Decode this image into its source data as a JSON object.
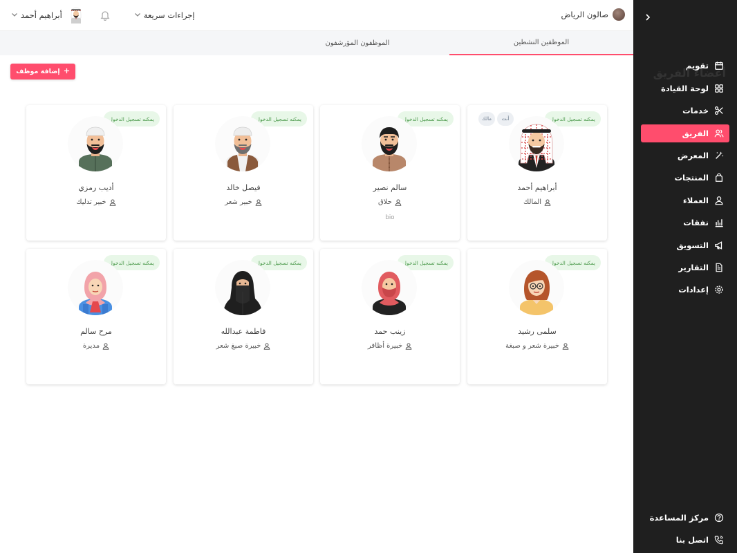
{
  "sidebar": {
    "items": [
      {
        "label": "تقويم",
        "icon": "calendar-icon",
        "active": false
      },
      {
        "label": "لوحة القيادة",
        "icon": "dashboard-grid-icon",
        "active": false
      },
      {
        "label": "خدمات",
        "icon": "scissors-icon",
        "active": false
      },
      {
        "label": "الفريق",
        "icon": "team-users-icon",
        "active": true
      },
      {
        "label": "المعرض",
        "icon": "sparkles-icon",
        "active": false
      },
      {
        "label": "المنتجات",
        "icon": "shopping-bag-icon",
        "active": false
      },
      {
        "label": "العملاء",
        "icon": "user-icon",
        "active": false
      },
      {
        "label": "نفقات",
        "icon": "bar-chart-icon",
        "active": false
      },
      {
        "label": "التسويق",
        "icon": "megaphone-icon",
        "active": false
      },
      {
        "label": "التقارير",
        "icon": "document-icon",
        "active": false
      },
      {
        "label": "إعدادات",
        "icon": "gear-icon",
        "active": false
      }
    ],
    "bottom": [
      {
        "label": "مركز المساعدة",
        "icon": "help-circle-icon"
      },
      {
        "label": "اتصل بنا",
        "icon": "phone-icon"
      }
    ]
  },
  "topbar": {
    "salon_name": "صالون الرياض",
    "quick_actions": "إجراءات سريعة",
    "user_name": "أبراهيم أحمد"
  },
  "tabs": {
    "active": "الموظفين النشطين",
    "archived": "الموظفون المؤرشفون"
  },
  "page": {
    "title": "أعضاء الفريق",
    "add_button": "إضافة موظف"
  },
  "members": [
    {
      "name": "أبراهيم أحمد",
      "role": "المالك",
      "login": "يمكنه تسجيل الدخول",
      "you": "أنت",
      "owner": "مالك",
      "bio": "",
      "avatar": "man-ghutra"
    },
    {
      "name": "سالم نصير",
      "role": "حلاق",
      "login": "يمكنه تسجيل الدخول",
      "bio": "bio",
      "avatar": "man-beard"
    },
    {
      "name": "فيصل خالد",
      "role": "خبير شعر",
      "login": "يمكنه تسجيل الدخول",
      "bio": "",
      "avatar": "man-cap-vest"
    },
    {
      "name": "أديب رمزي",
      "role": "خبير تدليك",
      "login": "يمكنه تسجيل الدخول",
      "bio": "",
      "avatar": "man-cap-green"
    },
    {
      "name": "سلمى رشيد",
      "role": "خبيرة شعر و صبغة",
      "login": "يمكنه تسجيل الدخول",
      "bio": "",
      "avatar": "woman-glasses"
    },
    {
      "name": "زينب حمد",
      "role": "خبيرة أظافر",
      "login": "يمكنه تسجيل الدخول",
      "bio": "",
      "avatar": "woman-hijab-red"
    },
    {
      "name": "فاطمة عبدالله",
      "role": "خبيرة صبغ شعر",
      "login": "يمكنه تسجيل الدخول",
      "bio": "",
      "avatar": "woman-niqab"
    },
    {
      "name": "مرح سالم",
      "role": "مديرة",
      "login": "يمكنه تسجيل الدخول",
      "bio": "",
      "avatar": "woman-hijab-pink"
    }
  ],
  "colors": {
    "accent": "#ff4d6d",
    "sidebar": "#1f1f1f",
    "login_badge_bg": "#e8f7e8",
    "login_badge_text": "#4c9a4c"
  }
}
